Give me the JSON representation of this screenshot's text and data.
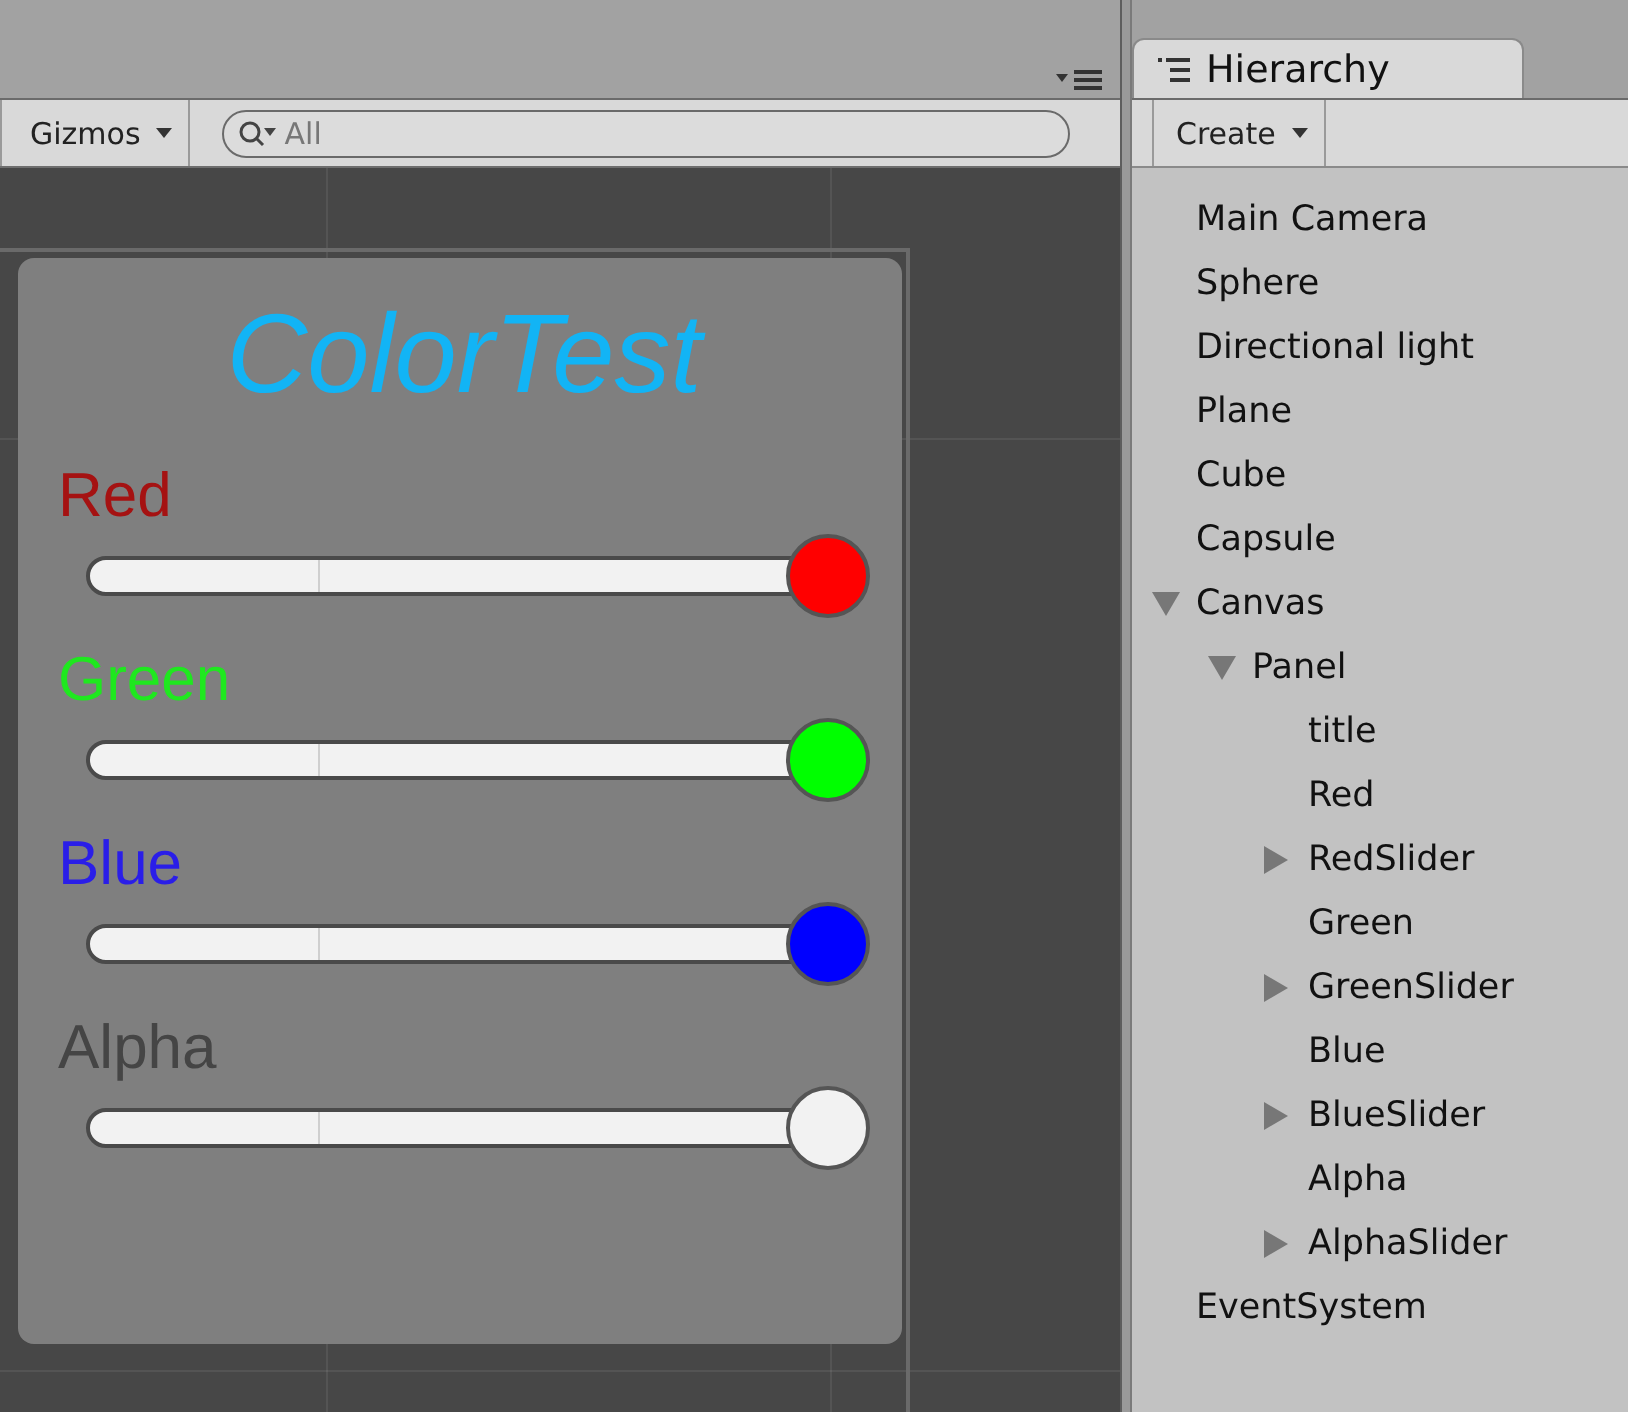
{
  "scene_toolbar": {
    "gizmos": "Gizmos",
    "search": {
      "placeholder": "All"
    }
  },
  "panel": {
    "title": "ColorTest",
    "sliders": [
      {
        "label": {
          "text": "Red",
          "color": "#a51212"
        },
        "color": "#ff0000",
        "level": 1
      },
      {
        "label": {
          "text": "Green",
          "color": "#1fe81f"
        },
        "color": "#00ff00",
        "level": 1
      },
      {
        "label": {
          "text": "Blue",
          "color": "#2a1ee8"
        },
        "color": "#0000ff",
        "level": 1
      },
      {
        "label": {
          "text": "Alpha",
          "color": "#454545"
        },
        "color": "#f2f2f2",
        "level": 1
      }
    ]
  },
  "hierarchy": {
    "tab": "Hierarchy",
    "create": "Create",
    "items": [
      {
        "name": "Main Camera"
      },
      {
        "name": "Sphere"
      },
      {
        "name": "Directional light"
      },
      {
        "name": "Plane"
      },
      {
        "name": "Cube"
      },
      {
        "name": "Capsule"
      },
      {
        "name": "Canvas",
        "expanded": true,
        "children": [
          {
            "name": "Panel",
            "expanded": true,
            "children": [
              {
                "name": "title"
              },
              {
                "name": "Red"
              },
              {
                "name": "RedSlider",
                "expanded": false
              },
              {
                "name": "Green"
              },
              {
                "name": "GreenSlider",
                "expanded": false
              },
              {
                "name": "Blue"
              },
              {
                "name": "BlueSlider",
                "expanded": false
              },
              {
                "name": "Alpha"
              },
              {
                "name": "AlphaSlider",
                "expanded": false
              }
            ]
          }
        ]
      },
      {
        "name": "EventSystem"
      }
    ]
  }
}
